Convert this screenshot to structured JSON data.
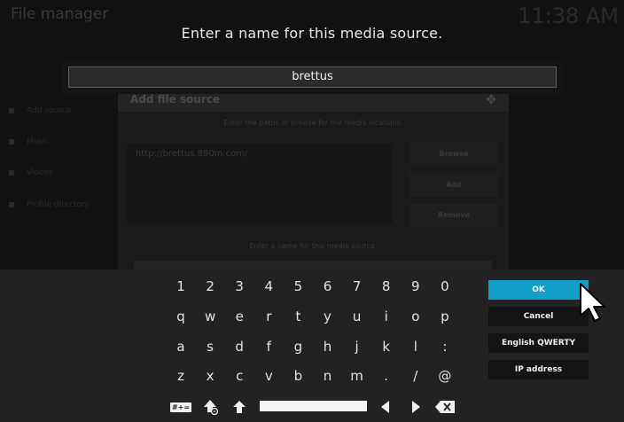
{
  "background": {
    "app_title": "File manager",
    "clock": "11:38 AM",
    "sidebar_items": [
      "Add source",
      "Music",
      "Videos",
      "Profile directory"
    ],
    "dialog": {
      "title": "Add file source",
      "hint_paths": "Enter the paths or browse for the media locations.",
      "path": "http://brettus.890m.com/",
      "browse": "Browse",
      "add": "Add",
      "remove": "Remove",
      "hint_name": "Enter a name for this media source."
    }
  },
  "dialog": {
    "prompt": "Enter a name for this media source.",
    "input_value": "brettus"
  },
  "keyboard": {
    "rows": [
      [
        "1",
        "2",
        "3",
        "4",
        "5",
        "6",
        "7",
        "8",
        "9",
        "0"
      ],
      [
        "q",
        "w",
        "e",
        "r",
        "t",
        "y",
        "u",
        "i",
        "o",
        "p"
      ],
      [
        "a",
        "s",
        "d",
        "f",
        "g",
        "h",
        "j",
        "k",
        "l",
        ":"
      ],
      [
        "z",
        "x",
        "c",
        "v",
        "b",
        "n",
        "m",
        ".",
        "/",
        "@"
      ]
    ],
    "symbols_label": "#+=",
    "buttons": {
      "ok": "OK",
      "cancel": "Cancel",
      "layout": "English QWERTY",
      "ip": "IP address"
    },
    "accent_color": "#12a0c8"
  }
}
